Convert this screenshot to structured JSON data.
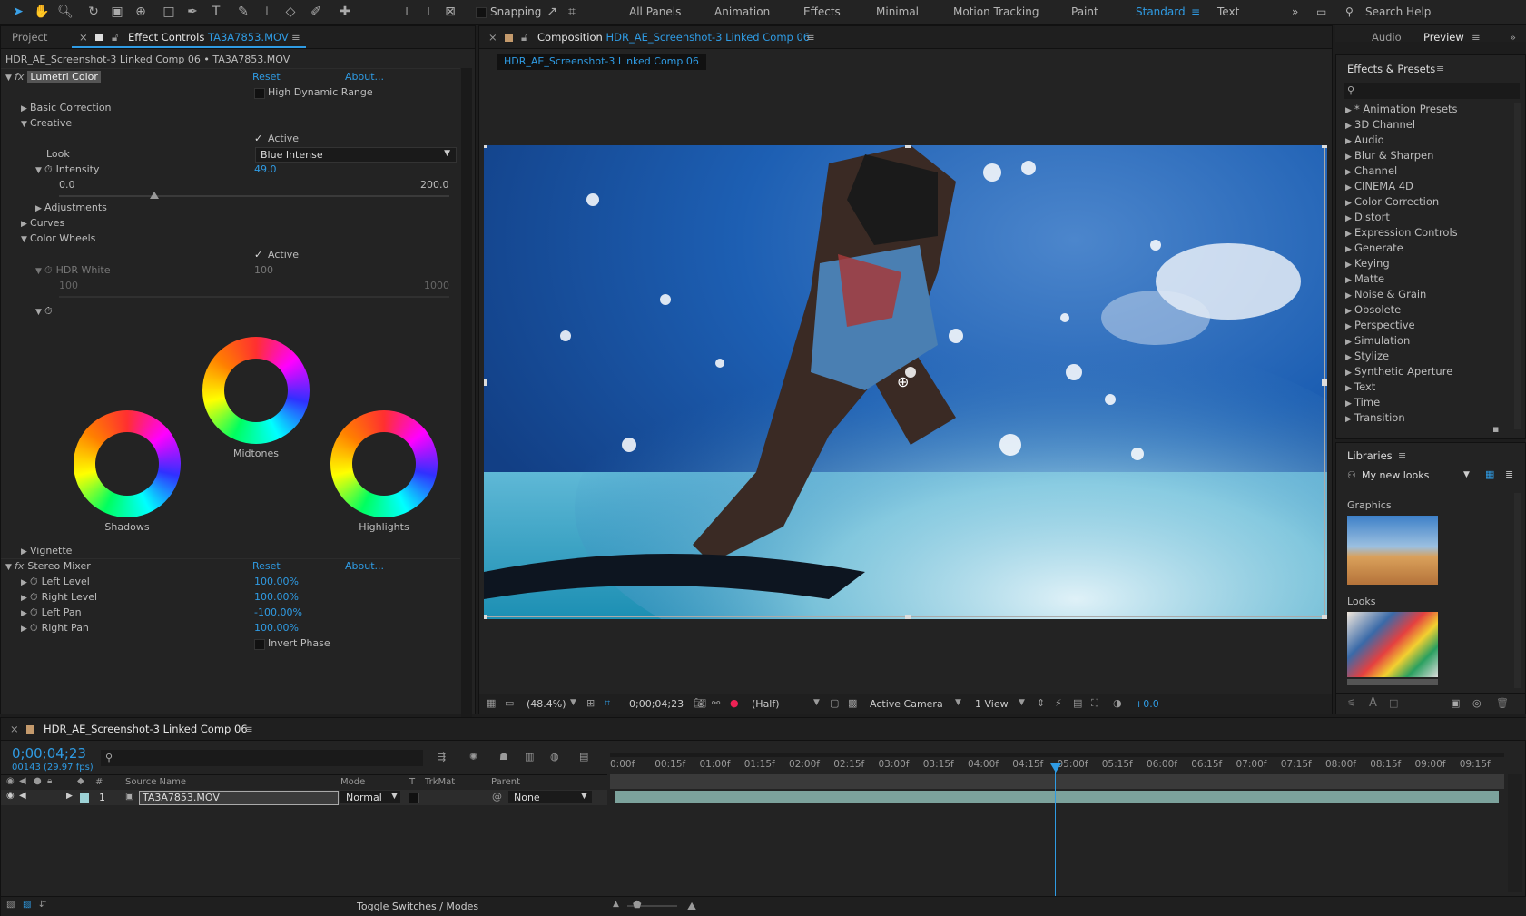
{
  "toolbar": {
    "snapping_label": "Snapping",
    "workspaces": [
      "All Panels",
      "Animation",
      "Effects",
      "Minimal",
      "Motion Tracking",
      "Paint",
      "Standard",
      "Text"
    ],
    "active_workspace": "Standard",
    "search_help_label": "Search Help"
  },
  "effect_controls": {
    "tab_project": "Project",
    "tab_effect_prefix": "Effect Controls",
    "tab_effect_file": "TA3A7853.MOV",
    "breadcrumb": "HDR_AE_Screenshot-3 Linked Comp 06 • TA3A7853.MOV",
    "lumetri": {
      "name": "Lumetri Color",
      "reset": "Reset",
      "about": "About...",
      "hdr_label": "High Dynamic Range",
      "basic_correction": "Basic Correction",
      "creative": "Creative",
      "active_label": "Active",
      "look_label": "Look",
      "look_value": "Blue Intense",
      "intensity_label": "Intensity",
      "intensity_value": "49.0",
      "intensity_min": "0.0",
      "intensity_max": "200.0",
      "intensity_fraction": 0.245,
      "adjustments": "Adjustments",
      "curves": "Curves",
      "color_wheels": "Color Wheels",
      "wheels_active": "Active",
      "hdr_white_label": "HDR White",
      "hdr_white_value": "100",
      "hdr_white_min": "100",
      "hdr_white_max": "1000",
      "midtones": "Midtones",
      "shadows": "Shadows",
      "highlights": "Highlights",
      "vignette": "Vignette"
    },
    "stereo": {
      "name": "Stereo Mixer",
      "reset": "Reset",
      "about": "About...",
      "params": [
        {
          "label": "Left Level",
          "value": "100.00%"
        },
        {
          "label": "Right Level",
          "value": "100.00%"
        },
        {
          "label": "Left Pan",
          "value": "-100.00%"
        },
        {
          "label": "Right Pan",
          "value": "100.00%"
        }
      ],
      "invert_phase": "Invert Phase"
    }
  },
  "composition": {
    "tab_prefix": "Composition",
    "tab_name": "HDR_AE_Screenshot-3 Linked Comp 06",
    "flow_label": "HDR_AE_Screenshot-3 Linked Comp 06",
    "zoom": "(48.4%)",
    "timecode": "0;00;04;23",
    "resolution": "(Half)",
    "camera": "Active Camera",
    "views": "1 View",
    "exposure": "+0.0"
  },
  "right_panels": {
    "tab_audio": "Audio",
    "tab_preview": "Preview",
    "effects_title": "Effects & Presets",
    "effects_list": [
      "* Animation Presets",
      "3D Channel",
      "Audio",
      "Blur & Sharpen",
      "Channel",
      "CINEMA 4D",
      "Color Correction",
      "Distort",
      "Expression Controls",
      "Generate",
      "Keying",
      "Matte",
      "Noise & Grain",
      "Obsolete",
      "Perspective",
      "Simulation",
      "Stylize",
      "Synthetic Aperture",
      "Text",
      "Time",
      "Transition"
    ],
    "libraries_title": "Libraries",
    "library_name": "My new looks",
    "graphics_label": "Graphics",
    "looks_label": "Looks"
  },
  "timeline": {
    "tab_name": "HDR_AE_Screenshot-3 Linked Comp 06",
    "timecode": "0;00;04;23",
    "frames": "00143 (29.97 fps)",
    "col_hash": "#",
    "col_source": "Source Name",
    "col_mode": "Mode",
    "col_t": "T",
    "col_trkmat": "TrkMat",
    "col_parent": "Parent",
    "layer_index": "1",
    "layer_name": "TA3A7853.MOV",
    "layer_mode": "Normal",
    "layer_parent": "None",
    "ruler": [
      "0:00f",
      "00:15f",
      "01:00f",
      "01:15f",
      "02:00f",
      "02:15f",
      "03:00f",
      "03:15f",
      "04:00f",
      "04:15f",
      "05:00f",
      "05:15f",
      "06:00f",
      "06:15f",
      "07:00f",
      "07:15f",
      "08:00f",
      "08:15f",
      "09:00f",
      "09:15f"
    ],
    "playhead_fraction": 0.497,
    "toggle_label": "Toggle Switches / Modes"
  },
  "colors": {
    "accent": "#2f9be3",
    "panel": "#232323",
    "bg": "#1d1d1d"
  }
}
